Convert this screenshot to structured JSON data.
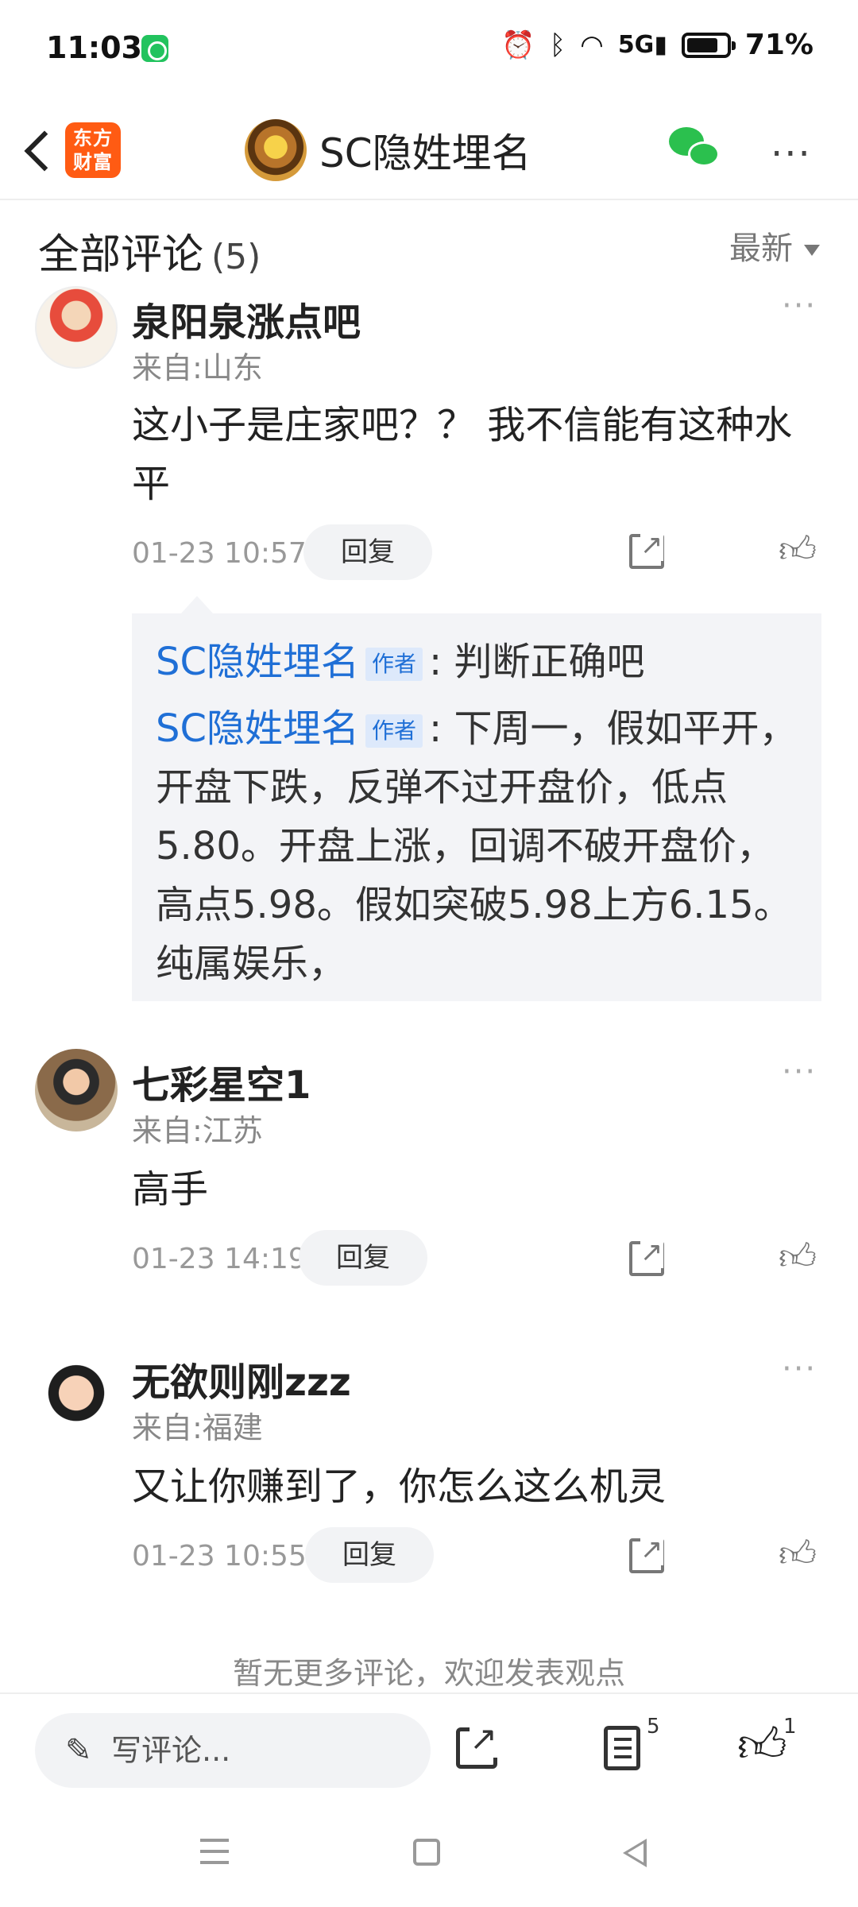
{
  "status_bar": {
    "time": "11:03",
    "battery": "71%",
    "network": "5G"
  },
  "nav": {
    "logo_line1": "东方",
    "logo_line2": "财富",
    "title": "SC隐姓埋名",
    "more": "···"
  },
  "comments_header": {
    "title": "全部评论",
    "count": "(5)",
    "sort_label": "最新"
  },
  "comments": [
    {
      "name": "泉阳泉涨点吧",
      "from": "来自:山东",
      "text": "这小子是庄家吧？？ 我不信能有这种水平",
      "time": "01-23 10:57",
      "reply_label": "回复"
    },
    {
      "name": "七彩星空1",
      "from": "来自:江苏",
      "text": "高手",
      "time": "01-23 14:19",
      "reply_label": "回复"
    },
    {
      "name": "无欲则刚zzz",
      "from": "来自:福建",
      "text": "又让你赚到了，你怎么这么机灵",
      "time": "01-23 10:55",
      "reply_label": "回复"
    }
  ],
  "replies": [
    {
      "name": "SC隐姓埋名",
      "tag": "作者",
      "text": ": 判断正确吧"
    },
    {
      "name": "SC隐姓埋名",
      "tag": "作者",
      "text": ": 下周一，假如平开，开盘下跌，反弹不过开盘价，低点5.80。开盘上涨，回调不破开盘价，高点5.98。假如突破5.98上方6.15。纯属娱乐，"
    }
  ],
  "no_more": "暂无更多评论，欢迎发表观点",
  "bottom": {
    "write_placeholder": "写评论...",
    "comment_count": "5",
    "like_count": "1"
  },
  "colors": {
    "brand": "#ff5b13",
    "link": "#1f6fd6",
    "wechat": "#2bc04e"
  }
}
